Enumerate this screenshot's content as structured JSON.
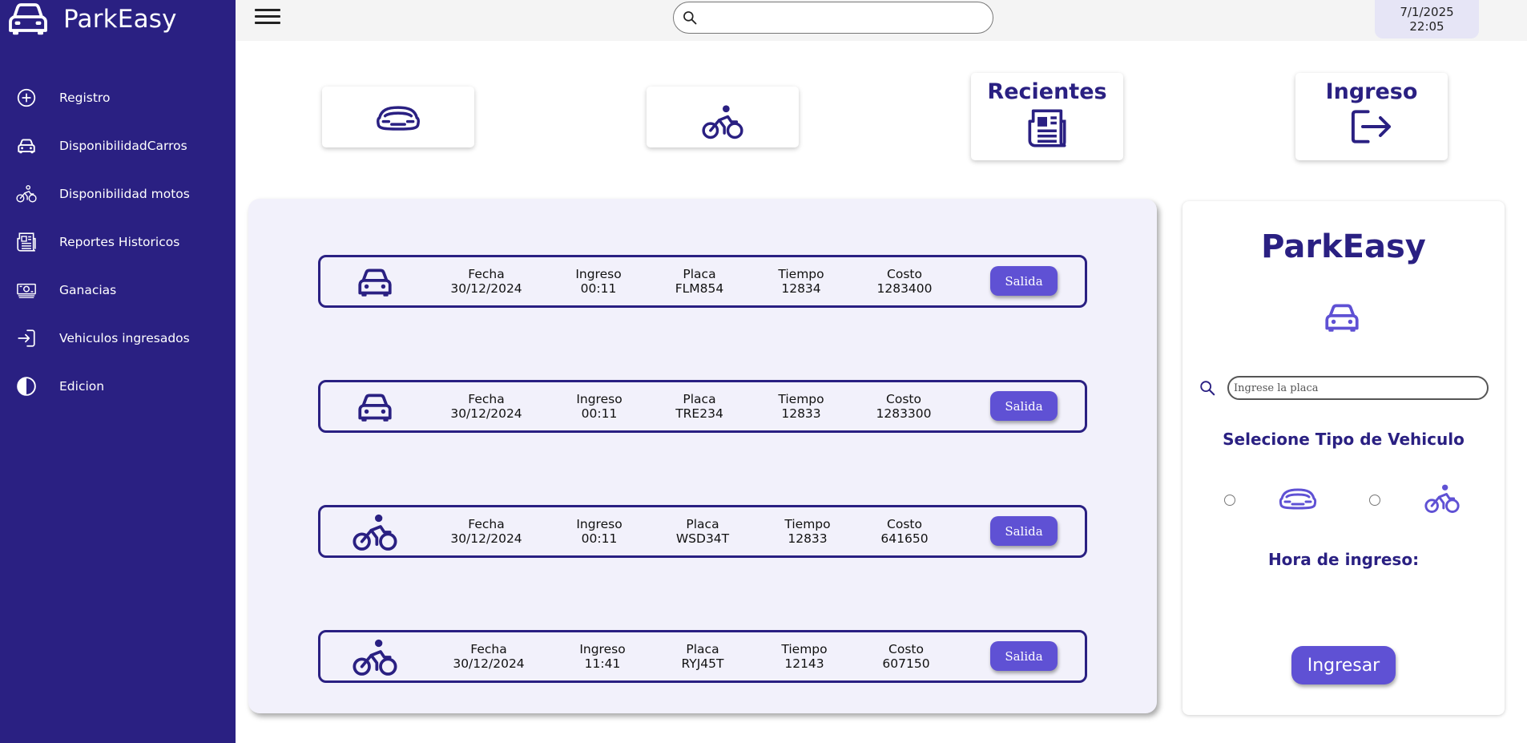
{
  "app": {
    "name": "ParkEasy"
  },
  "sidebar": {
    "items": [
      {
        "label": "Registro",
        "icon": "plus-circle-icon"
      },
      {
        "label": "DisponibilidadCarros",
        "icon": "car-icon"
      },
      {
        "label": "Disponibilidad motos",
        "icon": "bike-icon"
      },
      {
        "label": "Reportes Historicos",
        "icon": "newspaper-icon"
      },
      {
        "label": "Ganacias",
        "icon": "money-icon"
      },
      {
        "label": "Vehiculos ingresados",
        "icon": "login-icon"
      },
      {
        "label": "Edicion",
        "icon": "contrast-icon"
      }
    ]
  },
  "header": {
    "search_value": "",
    "date": "7/1/2025",
    "time": "22:05"
  },
  "cards": [
    {
      "title": "",
      "icon": "car-icon"
    },
    {
      "title": "",
      "icon": "bike-icon"
    },
    {
      "title": "Recientes",
      "icon": "newspaper-icon"
    },
    {
      "title": "Ingreso",
      "icon": "exit-arrow-icon"
    }
  ],
  "entries": [
    {
      "type": "car",
      "fecha_label": "Fecha",
      "fecha": "30/12/2024",
      "ingreso_label": "Ingreso",
      "ingreso": "00:11",
      "placa_label": "Placa",
      "placa": "FLM854",
      "tiempo_label": "Tiempo",
      "tiempo": "12834",
      "costo_label": "Costo",
      "costo": "1283400",
      "action": "Salida"
    },
    {
      "type": "car",
      "fecha_label": "Fecha",
      "fecha": "30/12/2024",
      "ingreso_label": "Ingreso",
      "ingreso": "00:11",
      "placa_label": "Placa",
      "placa": "TRE234",
      "tiempo_label": "Tiempo",
      "tiempo": "12833",
      "costo_label": "Costo",
      "costo": "1283300",
      "action": "Salida"
    },
    {
      "type": "bike",
      "fecha_label": "Fecha",
      "fecha": "30/12/2024",
      "ingreso_label": "Ingreso",
      "ingreso": "00:11",
      "placa_label": "Placa",
      "placa": "WSD34T",
      "tiempo_label": "Tiempo",
      "tiempo": "12833",
      "costo_label": "Costo",
      "costo": "641650",
      "action": "Salida"
    },
    {
      "type": "bike",
      "fecha_label": "Fecha",
      "fecha": "30/12/2024",
      "ingreso_label": "Ingreso",
      "ingreso": "11:41",
      "placa_label": "Placa",
      "placa": "RYJ45T",
      "tiempo_label": "Tiempo",
      "tiempo": "12143",
      "costo_label": "Costo",
      "costo": "607150",
      "action": "Salida"
    }
  ],
  "form": {
    "title": "ParkEasy",
    "placa_placeholder": "Ingrese la placa",
    "tipo_label": "Selecione Tipo de Vehiculo",
    "hora_label": "Hora de ingreso:",
    "submit_label": "Ingresar"
  },
  "colors": {
    "sidebar": "#2a2082",
    "accent": "#5f51d4",
    "panel": "#f2f1fb"
  }
}
